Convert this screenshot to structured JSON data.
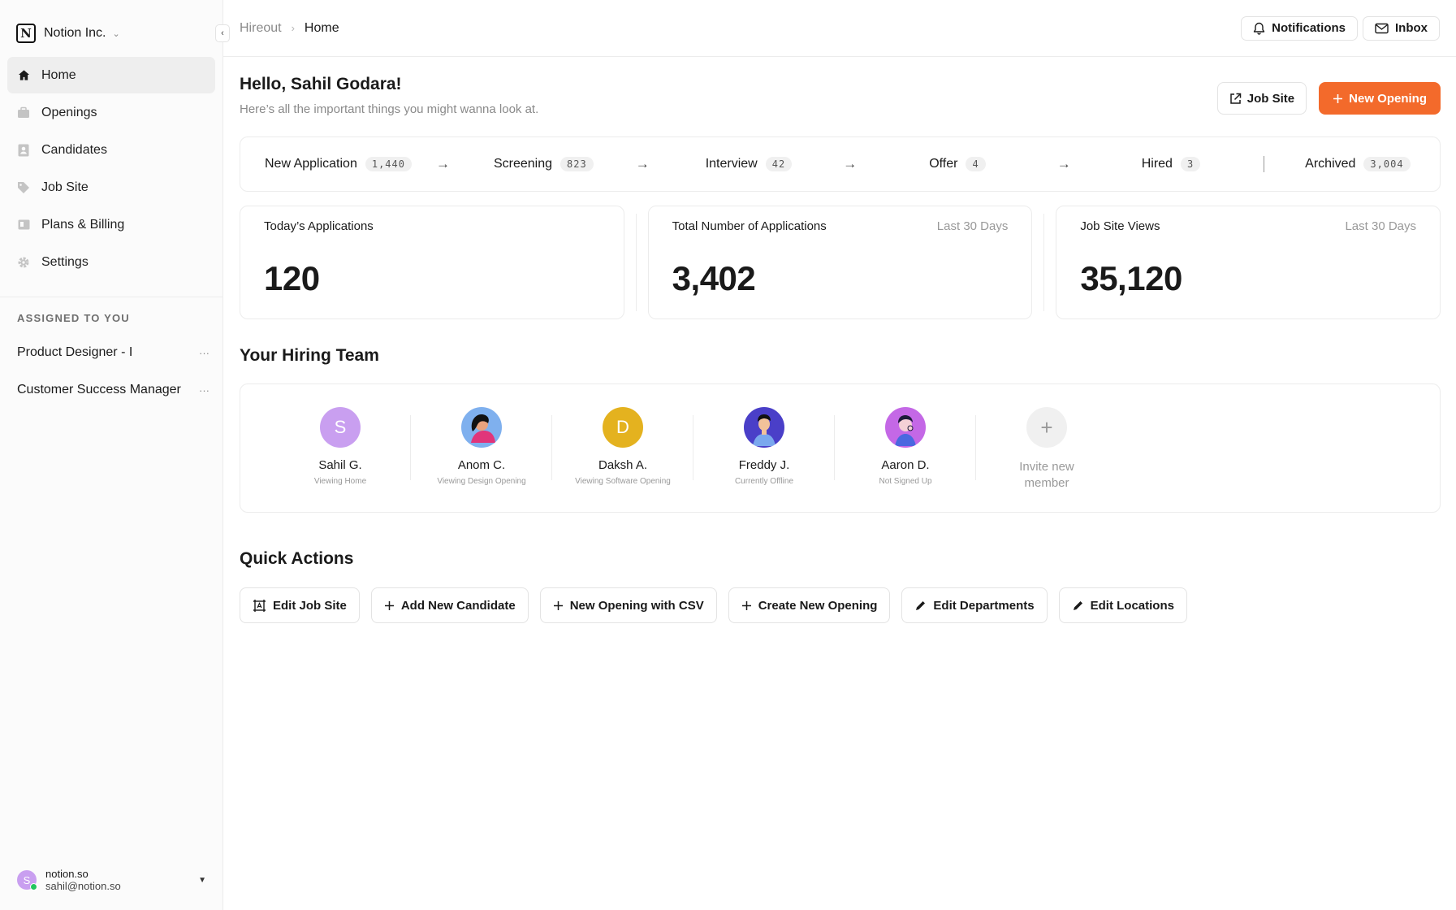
{
  "org": {
    "name": "Notion Inc."
  },
  "nav": [
    {
      "label": "Home",
      "icon": "home-icon",
      "active": true
    },
    {
      "label": "Openings",
      "icon": "briefcase-icon"
    },
    {
      "label": "Candidates",
      "icon": "contact-icon"
    },
    {
      "label": "Job Site",
      "icon": "tag-icon"
    },
    {
      "label": "Plans & Billing",
      "icon": "billing-icon"
    },
    {
      "label": "Settings",
      "icon": "gear-icon"
    }
  ],
  "assigned": {
    "title": "ASSIGNED TO YOU",
    "items": [
      {
        "label": "Product Designer - I"
      },
      {
        "label": "Customer Success Manager"
      }
    ]
  },
  "user": {
    "initial": "S",
    "name": "notion.so",
    "email": "sahil@notion.so"
  },
  "breadcrumb": {
    "root": "Hireout",
    "current": "Home"
  },
  "topbar": {
    "notifications": "Notifications",
    "inbox": "Inbox"
  },
  "greeting": {
    "title": "Hello, Sahil Godara!",
    "subtitle": "Here’s all the important things you might wanna look at."
  },
  "actions": {
    "job_site": "Job Site",
    "new_opening": "New Opening"
  },
  "pipeline": [
    {
      "label": "New Application",
      "count": "1,440"
    },
    {
      "label": "Screening",
      "count": "823"
    },
    {
      "label": "Interview",
      "count": "42"
    },
    {
      "label": "Offer",
      "count": "4"
    },
    {
      "label": "Hired",
      "count": "3"
    },
    {
      "label": "Archived",
      "count": "3,004"
    }
  ],
  "stats": [
    {
      "label": "Today’s Applications",
      "period": "",
      "value": "120"
    },
    {
      "label": "Total Number of Applications",
      "period": "Last 30 Days",
      "value": "3,402"
    },
    {
      "label": "Job Site Views",
      "period": "Last 30 Days",
      "value": "35,120"
    }
  ],
  "team": {
    "title": "Your Hiring Team",
    "members": [
      {
        "name": "Sahil G.",
        "status": "Viewing Home",
        "initial": "S",
        "color": "#c99ff0"
      },
      {
        "name": "Anom C.",
        "status": "Viewing Design Opening",
        "initial": "",
        "color": "#7fb0ee"
      },
      {
        "name": "Daksh A.",
        "status": "Viewing Software Opening",
        "initial": "D",
        "color": "#e4b21f"
      },
      {
        "name": "Freddy J.",
        "status": "Currently Offline",
        "initial": "",
        "color": "#4a3fc8"
      },
      {
        "name": "Aaron D.",
        "status": "Not Signed Up",
        "initial": "",
        "color": "#c468e6"
      }
    ],
    "invite": {
      "line1": "Invite new",
      "line2": "member"
    }
  },
  "quick_actions": {
    "title": "Quick Actions",
    "items": [
      {
        "label": "Edit Job Site",
        "icon": "frame-icon"
      },
      {
        "label": "Add New Candidate",
        "icon": "plus-icon"
      },
      {
        "label": "New Opening with CSV",
        "icon": "plus-icon"
      },
      {
        "label": "Create New Opening",
        "icon": "plus-icon"
      },
      {
        "label": "Edit Departments",
        "icon": "pencil-icon"
      },
      {
        "label": "Edit Locations",
        "icon": "pencil-icon"
      }
    ]
  },
  "colors": {
    "accent": "#f36a2b",
    "online": "#22c55e"
  }
}
